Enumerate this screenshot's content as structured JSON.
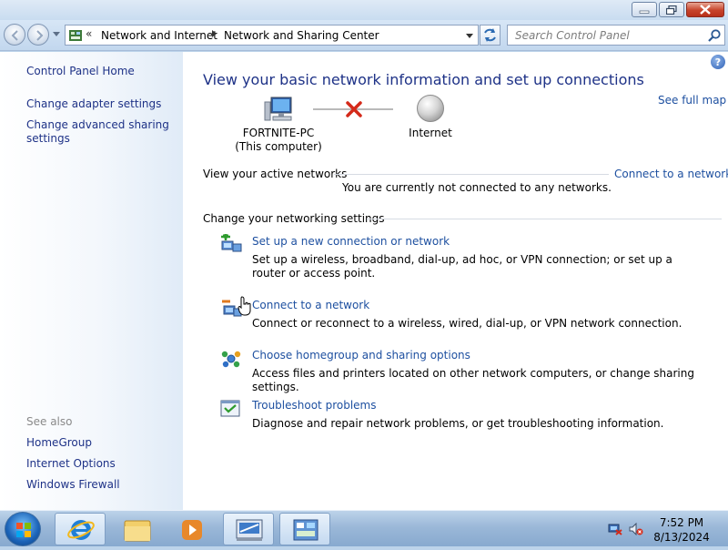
{
  "window": {
    "minimize_icon": "minimize-icon",
    "maximize_icon": "restore-icon",
    "close_icon": "close-icon"
  },
  "navbar": {
    "breadcrumb": [
      "Network and Internet",
      "Network and Sharing Center"
    ],
    "search_placeholder": "Search Control Panel"
  },
  "sidebar": {
    "home": "Control Panel Home",
    "links": [
      "Change adapter settings",
      "Change advanced sharing",
      "settings"
    ],
    "see_also_title": "See also",
    "see_also": [
      "HomeGroup",
      "Internet Options",
      "Windows Firewall"
    ]
  },
  "main": {
    "heading": "View your basic network information and set up connections",
    "see_full_map": "See full map",
    "computer_name": "FORTNITE-PC",
    "computer_sub": "(This computer)",
    "internet": "Internet",
    "active_networks_title": "View your active networks",
    "connect_link": "Connect to a network",
    "not_connected": "You are currently not connected to any networks.",
    "change_settings_title": "Change your networking settings",
    "tasks": [
      {
        "title": "Set up a new connection or network",
        "desc": "Set up a wireless, broadband, dial-up, ad hoc, or VPN connection; or set up a router or access point."
      },
      {
        "title": "Connect to a network",
        "desc": "Connect or reconnect to a wireless, wired, dial-up, or VPN network connection."
      },
      {
        "title": "Choose homegroup and sharing options",
        "desc": "Access files and printers located on other network computers, or change sharing settings."
      },
      {
        "title": "Troubleshoot problems",
        "desc": "Diagnose and repair network problems, or get troubleshooting information."
      }
    ]
  },
  "taskbar": {
    "time": "7:52 PM",
    "date": "8/13/2024"
  },
  "colors": {
    "link": "#1e50a0",
    "heading": "#1e3287",
    "error_x": "#d42a1a"
  }
}
